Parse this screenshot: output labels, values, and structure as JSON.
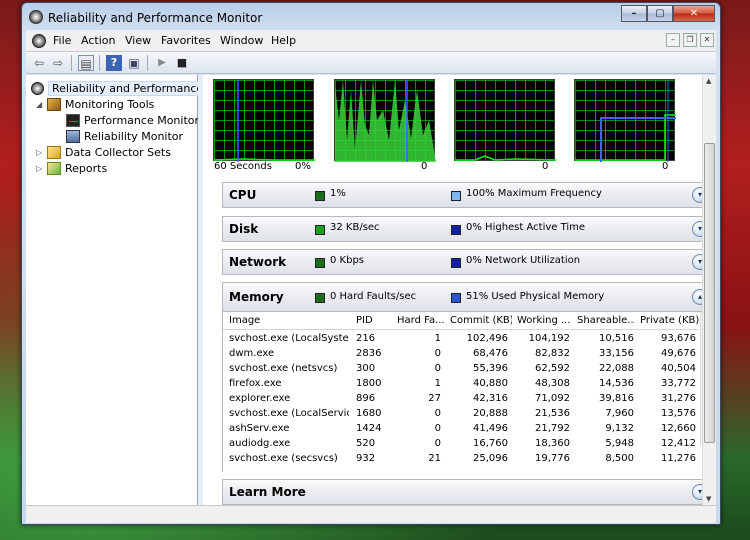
{
  "window": {
    "title": "Reliability and Performance Monitor"
  },
  "window_buttons": {
    "minimize": "–",
    "maximize": "▢",
    "close": "✕"
  },
  "menu": {
    "items": [
      "File",
      "Action",
      "View",
      "Favorites",
      "Window",
      "Help"
    ]
  },
  "mdi_buttons": {
    "minimize": "–",
    "restore": "❐",
    "close": "✕"
  },
  "toolbar": {
    "icons": [
      "back-icon",
      "forward-icon",
      "show-hide-tree-icon",
      "help-icon",
      "properties-icon",
      "start-icon",
      "stop-icon"
    ],
    "glyphs": {
      "back": "⇦",
      "forward": "⇨",
      "tree": "▤",
      "help": "?",
      "props": "▣",
      "start": "▶",
      "stop": "■"
    }
  },
  "tree": {
    "root": "Reliability and Performance",
    "monitoring_tools": "Monitoring Tools",
    "performance_monitor": "Performance Monitor",
    "reliability_monitor": "Reliability Monitor",
    "data_collector_sets": "Data Collector Sets",
    "reports": "Reports",
    "expand_open": "◢",
    "expand_closed": "▷"
  },
  "graphs": [
    {
      "left_label": "60 Seconds",
      "right_label": "0%"
    },
    {
      "left_label": "",
      "right_label": "0"
    },
    {
      "left_label": "",
      "right_label": "0"
    },
    {
      "left_label": "",
      "right_label": "0"
    }
  ],
  "sections": {
    "cpu": {
      "title": "CPU",
      "stat1": "1%",
      "stat2": "100% Maximum Frequency",
      "color1": "#1a6b1a",
      "color2": "#7fb6f0",
      "toggle": "▾"
    },
    "disk": {
      "title": "Disk",
      "stat1": "32 KB/sec",
      "stat2": "0% Highest Active Time",
      "color1": "#1aa01a",
      "color2": "#1020a8",
      "toggle": "▾"
    },
    "network": {
      "title": "Network",
      "stat1": "0 Kbps",
      "stat2": "0% Network Utilization",
      "color1": "#1a6b1a",
      "color2": "#1020a8",
      "toggle": "▾"
    },
    "memory": {
      "title": "Memory",
      "stat1": "0 Hard Faults/sec",
      "stat2": "51% Used Physical Memory",
      "color1": "#1a6b1a",
      "color2": "#2a56d8",
      "toggle": "▴"
    },
    "learn_more": {
      "title": "Learn More",
      "toggle": "▾"
    }
  },
  "memory_table": {
    "columns": [
      "Image",
      "PID",
      "Hard Fa...",
      "Commit (KB)",
      "Working ...",
      "Shareable...",
      "Private (KB)"
    ],
    "rows": [
      [
        "svchost.exe (LocalSystem...",
        "216",
        "1",
        "102,496",
        "104,192",
        "10,516",
        "93,676"
      ],
      [
        "dwm.exe",
        "2836",
        "0",
        "68,476",
        "82,832",
        "33,156",
        "49,676"
      ],
      [
        "svchost.exe (netsvcs)",
        "300",
        "0",
        "55,396",
        "62,592",
        "22,088",
        "40,504"
      ],
      [
        "firefox.exe",
        "1800",
        "1",
        "40,880",
        "48,308",
        "14,536",
        "33,772"
      ],
      [
        "explorer.exe",
        "896",
        "27",
        "42,316",
        "71,092",
        "39,816",
        "31,276"
      ],
      [
        "svchost.exe (LocalService...",
        "1680",
        "0",
        "20,888",
        "21,536",
        "7,960",
        "13,576"
      ],
      [
        "ashServ.exe",
        "1424",
        "0",
        "41,496",
        "21,792",
        "9,132",
        "12,660"
      ],
      [
        "audiodg.exe",
        "520",
        "0",
        "16,760",
        "18,360",
        "5,948",
        "12,412"
      ],
      [
        "svchost.exe (secsvcs)",
        "932",
        "21",
        "25,096",
        "19,776",
        "8,500",
        "11,276"
      ]
    ]
  },
  "scroll": {
    "up": "▲",
    "down": "▼"
  }
}
